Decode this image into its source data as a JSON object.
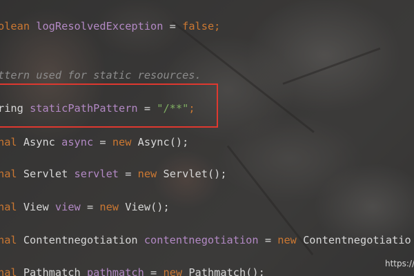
{
  "editor": {
    "lines": [
      {
        "id": "line-log-resolved",
        "tokens": [
          {
            "cls": "kw",
            "text": "olean "
          },
          {
            "cls": "fld",
            "text": "logResolvedException"
          },
          {
            "cls": "op",
            "text": " = "
          },
          {
            "cls": "kw",
            "text": "false"
          },
          {
            "cls": "kw",
            "text": ";"
          }
        ]
      },
      {
        "id": "line-comment",
        "tokens": [
          {
            "cls": "cmt",
            "text": "ttern used for static resources."
          }
        ]
      },
      {
        "id": "line-static-path",
        "tokens": [
          {
            "cls": "ty",
            "text": "ring "
          },
          {
            "cls": "fld",
            "text": "staticPathPattern"
          },
          {
            "cls": "op",
            "text": " = "
          },
          {
            "cls": "str2",
            "text": "\"/**\""
          },
          {
            "cls": "kw",
            "text": ";"
          }
        ]
      },
      {
        "id": "line-async",
        "tokens": [
          {
            "cls": "kw",
            "text": "nal "
          },
          {
            "cls": "ty",
            "text": "Async "
          },
          {
            "cls": "fld",
            "text": "async"
          },
          {
            "cls": "op",
            "text": " = "
          },
          {
            "cls": "kw",
            "text": "new "
          },
          {
            "cls": "ty",
            "text": "Async();"
          }
        ]
      },
      {
        "id": "line-servlet",
        "tokens": [
          {
            "cls": "kw",
            "text": "nal "
          },
          {
            "cls": "ty",
            "text": "Servlet "
          },
          {
            "cls": "fld",
            "text": "servlet"
          },
          {
            "cls": "op",
            "text": " = "
          },
          {
            "cls": "kw",
            "text": "new "
          },
          {
            "cls": "ty",
            "text": "Servlet();"
          }
        ]
      },
      {
        "id": "line-view",
        "tokens": [
          {
            "cls": "kw",
            "text": "nal "
          },
          {
            "cls": "ty",
            "text": "View "
          },
          {
            "cls": "fld",
            "text": "view"
          },
          {
            "cls": "op",
            "text": " = "
          },
          {
            "cls": "kw",
            "text": "new "
          },
          {
            "cls": "ty",
            "text": "View();"
          }
        ]
      },
      {
        "id": "line-contentnegotiation",
        "tokens": [
          {
            "cls": "kw",
            "text": "nal "
          },
          {
            "cls": "ty",
            "text": "Contentnegotiation "
          },
          {
            "cls": "fld",
            "text": "contentnegotiation"
          },
          {
            "cls": "op",
            "text": " = "
          },
          {
            "cls": "kw",
            "text": "new "
          },
          {
            "cls": "ty",
            "text": "Contentnegotiatio"
          }
        ]
      },
      {
        "id": "line-pathmatch",
        "tokens": [
          {
            "cls": "kw",
            "text": "nal "
          },
          {
            "cls": "ty",
            "text": "Pathmatch "
          },
          {
            "cls": "fld",
            "text": "pathmatch"
          },
          {
            "cls": "op",
            "text": " = "
          },
          {
            "cls": "kw",
            "text": "new "
          },
          {
            "cls": "ty",
            "text": "Pathmatch();"
          }
        ]
      }
    ],
    "highlight_color": "#e0382f"
  },
  "watermark": {
    "text": "https://"
  },
  "colors": {
    "keyword": "#cc7832",
    "field": "#b389c5",
    "string": "#6a9955",
    "comment": "#8c8c8c",
    "plain": "#d8d8d8"
  }
}
